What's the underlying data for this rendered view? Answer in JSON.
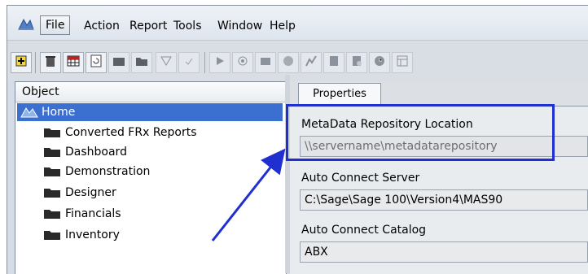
{
  "menu": {
    "items": [
      "File",
      "Action",
      "Report",
      "Tools",
      "Window",
      "Help"
    ],
    "active": "File"
  },
  "toolbar": {
    "buttons": [
      "new-item-icon",
      "delete-icon",
      "grid-icon",
      "refresh-icon",
      "report-design-icon",
      "folder-dark-icon",
      "filter-icon",
      "check-icon",
      "play-icon",
      "connect-icon",
      "view-icon",
      "globe-icon",
      "chart-icon",
      "print-icon",
      "print-preview-icon",
      "clock-icon",
      "layout-icon"
    ]
  },
  "object_panel": {
    "header": "Object",
    "root": "Home",
    "folders": [
      "Converted FRx Reports",
      "Dashboard",
      "Demonstration",
      "Designer",
      "Financials",
      "Inventory"
    ]
  },
  "properties": {
    "tab": "Properties",
    "fields": [
      {
        "label": "MetaData Repository Location",
        "value": "\\\\servername\\metadatarepository"
      },
      {
        "label": "Auto Connect Server",
        "value": "C:\\Sage\\Sage 100\\Version4\\MAS90"
      },
      {
        "label": "Auto Connect Catalog",
        "value": "ABX"
      }
    ]
  },
  "colors": {
    "highlight_box": "#1f2fd0",
    "arrow": "#1f2fd0",
    "selection": "#3b6fd0"
  }
}
